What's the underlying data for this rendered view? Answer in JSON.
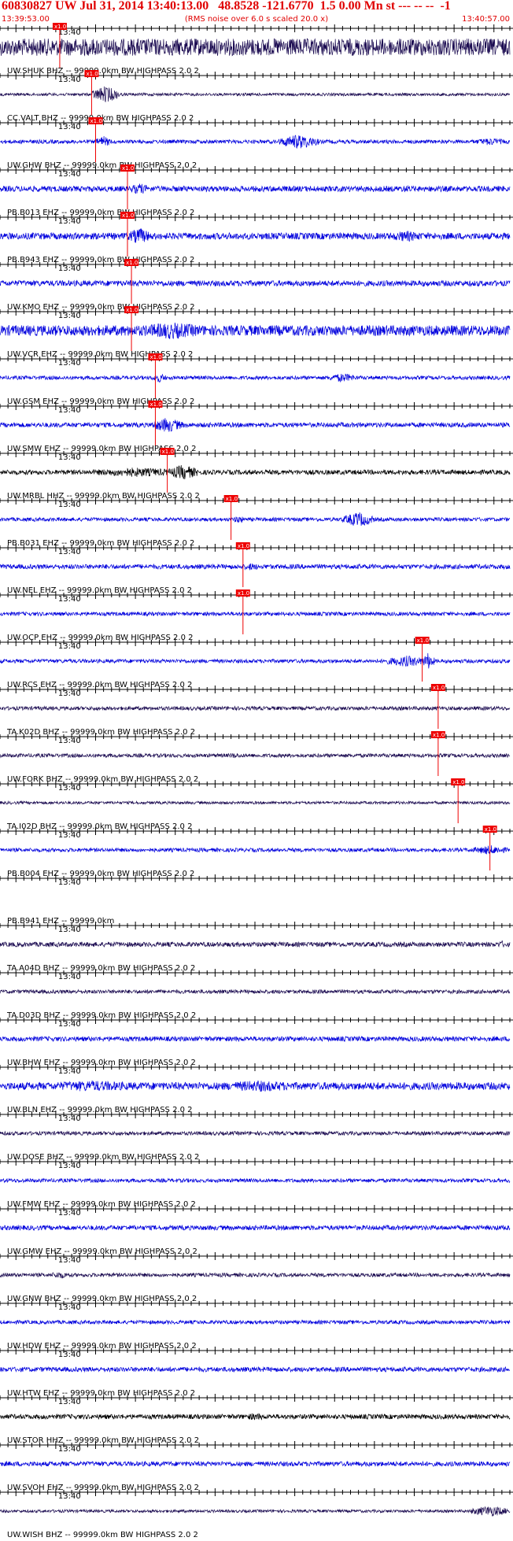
{
  "header": {
    "title": "60830827 UW Jul 31, 2014 13:40:13.00   48.8528 -121.6770  1.5 0.00 Mn st --- -- --  -1",
    "start_time": "13:39:53.00",
    "scaling_note": "(RMS noise over 6.0 s scaled 20.0 x)",
    "end_time": "13:40:57.00"
  },
  "chart_data": {
    "type": "seismogram",
    "time_window": [
      "13:39:53.00",
      "13:40:57.00"
    ],
    "tick_label": "13:40",
    "pick_label": "x1.0",
    "colors": {
      "blue": "#0000dd",
      "navy": "#1a0a50",
      "black": "#000000",
      "pick": "#ee0000",
      "axis": "#000000"
    },
    "traces": [
      {
        "label": "UW.SHUK BHZ -- 99999.0km BW  HIGHPASS  2.0  2",
        "color": "navy",
        "pick_s": 7.5,
        "amp": 0.9,
        "bursts": [
          [
            14,
            15,
            0.6
          ],
          [
            20,
            26,
            0.8
          ],
          [
            42,
            44,
            0.6
          ],
          [
            51,
            53,
            0.7
          ]
        ]
      },
      {
        "label": "CC.VALT BHZ -- 99999.0km BW  HIGHPASS  2.0  2",
        "color": "navy",
        "pick_s": 11.5,
        "amp": 0.15,
        "bursts": [
          [
            11.5,
            15,
            0.9
          ]
        ]
      },
      {
        "label": "UW.GHW BHZ -- 99999.0km BW  HIGHPASS  2.0  2",
        "color": "blue",
        "pick_s": 12.0,
        "amp": 0.2,
        "bursts": [
          [
            12,
            14,
            0.6
          ],
          [
            35,
            40,
            0.8
          ],
          [
            59,
            64,
            0.4
          ]
        ]
      },
      {
        "label": "PB.B013 EHZ -- 99999.0km BW  HIGHPASS  2.0  2",
        "color": "blue",
        "pick_s": 16.0,
        "amp": 0.3,
        "bursts": [
          [
            16,
            19,
            0.6
          ],
          [
            49,
            53,
            0.4
          ]
        ]
      },
      {
        "label": "PB.B943 EHZ -- 99999.0km BW  HIGHPASS  2.0  2",
        "color": "blue",
        "pick_s": 16.0,
        "amp": 0.35,
        "bursts": [
          [
            16,
            19,
            0.9
          ],
          [
            48,
            54,
            0.6
          ]
        ]
      },
      {
        "label": "UW.KMO EHZ -- 99999.0km BW  HIGHPASS  2.0  2",
        "color": "blue",
        "pick_s": 16.5,
        "amp": 0.3,
        "bursts": []
      },
      {
        "label": "UW.VCR EHZ -- 99999.0km BW  HIGHPASS  2.0  2",
        "color": "blue",
        "pick_s": 16.5,
        "amp": 0.55,
        "bursts": [
          [
            16,
            27,
            0.9
          ],
          [
            62,
            64,
            0.5
          ]
        ]
      },
      {
        "label": "UW.GSM EHZ -- 99999.0km BW  HIGHPASS  2.0  2",
        "color": "blue",
        "pick_s": 19.5,
        "amp": 0.2,
        "bursts": [
          [
            19,
            21,
            0.5
          ],
          [
            41,
            45,
            0.5
          ]
        ]
      },
      {
        "label": "UW.SMW EHZ -- 99999.0km BW  HIGHPASS  2.0  2",
        "color": "blue",
        "pick_s": 19.5,
        "amp": 0.25,
        "bursts": [
          [
            19,
            23,
            0.8
          ]
        ]
      },
      {
        "label": "UW.MRBL HHZ -- 99999.0km BW  HIGHPASS  2.0  2",
        "color": "black",
        "pick_s": 21.0,
        "amp": 0.25,
        "bursts": [
          [
            10,
            24,
            0.5
          ],
          [
            21,
            25,
            0.8
          ]
        ]
      },
      {
        "label": "PB.B031 EHZ -- 99999.0km BW  HIGHPASS  2.0  2",
        "color": "blue",
        "pick_s": 29.0,
        "amp": 0.2,
        "bursts": [
          [
            29,
            31,
            0.4
          ],
          [
            43,
            47,
            0.8
          ]
        ]
      },
      {
        "label": "UW.NEL EHZ -- 99999.0km BW  HIGHPASS  2.0  2",
        "color": "blue",
        "pick_s": 30.5,
        "amp": 0.25,
        "bursts": [
          [
            30,
            33,
            0.4
          ]
        ]
      },
      {
        "label": "UW.OCP EHZ -- 99999.0km BW  HIGHPASS  2.0  2",
        "color": "blue",
        "pick_s": 30.5,
        "amp": 0.2,
        "bursts": []
      },
      {
        "label": "UW.RCS EHZ -- 99999.0km BW  HIGHPASS  2.0  2",
        "color": "blue",
        "pick_s": 53.0,
        "amp": 0.2,
        "bursts": [
          [
            48,
            54,
            0.6
          ],
          [
            53,
            54.5,
            0.9
          ]
        ]
      },
      {
        "label": "TA.K02D BHZ -- 99999.0km BW  HIGHPASS  2.0  2",
        "color": "navy",
        "pick_s": 55.0,
        "amp": 0.2,
        "bursts": []
      },
      {
        "label": "UW.FORK BHZ -- 99999.0km BW  HIGHPASS  2.0  2",
        "color": "navy",
        "pick_s": 55.0,
        "amp": 0.2,
        "bursts": [
          [
            28,
            31,
            0.3
          ]
        ]
      },
      {
        "label": "TA.I02D BHZ -- 99999.0km BW  HIGHPASS  2.0  2",
        "color": "navy",
        "pick_s": 57.5,
        "amp": 0.15,
        "bursts": []
      },
      {
        "label": "PB.B004 EHZ -- 99999.0km BW  HIGHPASS  2.0  2",
        "color": "blue",
        "pick_s": 61.5,
        "amp": 0.2,
        "bursts": [
          [
            59,
            64,
            0.5
          ]
        ]
      },
      {
        "label": "PB.B941 EHZ -- 99999.0km",
        "color": "blue",
        "pick_s": null,
        "amp": 0.0,
        "bursts": []
      },
      {
        "label": "TA.A04D BHZ -- 99999.0km BW  HIGHPASS  2.0  2",
        "color": "navy",
        "pick_s": null,
        "amp": 0.25,
        "bursts": [
          [
            62,
            64,
            0.4
          ]
        ]
      },
      {
        "label": "TA.D03D BHZ -- 99999.0km BW  HIGHPASS  2.0  2",
        "color": "navy",
        "pick_s": null,
        "amp": 0.2,
        "bursts": []
      },
      {
        "label": "UW.BHW EHZ -- 99999.0km BW  HIGHPASS  2.0  2",
        "color": "blue",
        "pick_s": null,
        "amp": 0.25,
        "bursts": []
      },
      {
        "label": "UW.BLN EHZ -- 99999.0km BW  HIGHPASS  2.0  2",
        "color": "blue",
        "pick_s": null,
        "amp": 0.4,
        "bursts": [
          [
            3,
            20,
            0.6
          ],
          [
            25,
            40,
            0.6
          ]
        ]
      },
      {
        "label": "UW.DOSE BHZ -- 99999.0km BW  HIGHPASS  2.0  2",
        "color": "navy",
        "pick_s": null,
        "amp": 0.2,
        "bursts": []
      },
      {
        "label": "UW.FMW EHZ -- 99999.0km BW  HIGHPASS  2.0  2",
        "color": "blue",
        "pick_s": null,
        "amp": 0.2,
        "bursts": []
      },
      {
        "label": "UW.GMW EHZ -- 99999.0km BW  HIGHPASS  2.0  2",
        "color": "blue",
        "pick_s": null,
        "amp": 0.25,
        "bursts": []
      },
      {
        "label": "UW.GNW BHZ -- 99999.0km BW  HIGHPASS  2.0  2",
        "color": "navy",
        "pick_s": null,
        "amp": 0.2,
        "bursts": [
          [
            6,
            9,
            0.4
          ]
        ]
      },
      {
        "label": "UW.HDW EHZ -- 99999.0km BW  HIGHPASS  2.0  2",
        "color": "blue",
        "pick_s": null,
        "amp": 0.2,
        "bursts": []
      },
      {
        "label": "UW.HTW EHZ -- 99999.0km BW  HIGHPASS  2.0  2",
        "color": "blue",
        "pick_s": null,
        "amp": 0.25,
        "bursts": []
      },
      {
        "label": "UW.STOR HHZ -- 99999.0km BW  HIGHPASS  2.0  2",
        "color": "black",
        "pick_s": null,
        "amp": 0.25,
        "bursts": [
          [
            30,
            34,
            0.4
          ]
        ]
      },
      {
        "label": "UW.SVOH EHZ -- 99999.0km BW  HIGHPASS  2.0  2",
        "color": "blue",
        "pick_s": null,
        "amp": 0.25,
        "bursts": []
      },
      {
        "label": "UW.WISH BHZ -- 99999.0km BW  HIGHPASS  2.0  2",
        "color": "navy",
        "pick_s": null,
        "amp": 0.15,
        "bursts": [
          [
            59,
            64,
            0.6
          ]
        ]
      }
    ]
  }
}
